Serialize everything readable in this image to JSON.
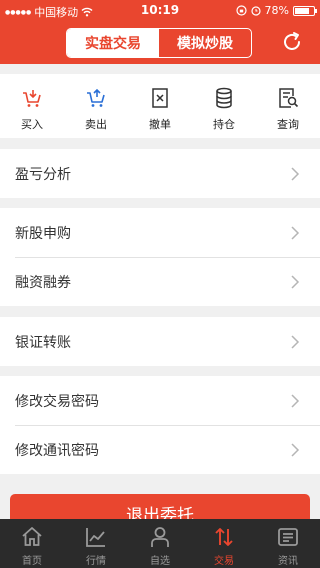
{
  "status_bar": {
    "carrier": "中国移动",
    "time": "10:19",
    "battery": "78%",
    "battery_level": 0.78
  },
  "header": {
    "tabs": [
      {
        "label": "实盘交易",
        "active": true
      },
      {
        "label": "模拟炒股",
        "active": false
      }
    ],
    "refresh_icon": "refresh-icon"
  },
  "actions": [
    {
      "label": "买入",
      "icon": "cart-in-icon",
      "color": "#e9462f"
    },
    {
      "label": "卖出",
      "icon": "cart-out-icon",
      "color": "#2a6fd6"
    },
    {
      "label": "撤单",
      "icon": "cancel-order-icon",
      "color": "#333333"
    },
    {
      "label": "持仓",
      "icon": "holdings-icon",
      "color": "#333333"
    },
    {
      "label": "查询",
      "icon": "query-icon",
      "color": "#333333"
    }
  ],
  "menu_groups": [
    {
      "items": [
        {
          "label": "盈亏分析"
        }
      ]
    },
    {
      "items": [
        {
          "label": "新股申购"
        },
        {
          "label": "融资融券"
        }
      ]
    },
    {
      "items": [
        {
          "label": "银证转账"
        }
      ]
    },
    {
      "items": [
        {
          "label": "修改交易密码"
        },
        {
          "label": "修改通讯密码"
        }
      ]
    }
  ],
  "logout_label": "退出委托",
  "tabbar": [
    {
      "label": "首页",
      "icon": "home-icon",
      "active": false
    },
    {
      "label": "行情",
      "icon": "market-chart-icon",
      "active": false
    },
    {
      "label": "自选",
      "icon": "person-icon",
      "active": false
    },
    {
      "label": "交易",
      "icon": "trade-icon",
      "active": true
    },
    {
      "label": "资讯",
      "icon": "news-icon",
      "active": false
    }
  ],
  "colors": {
    "accent": "#e9462f",
    "tabbar_bg": "#2b2b2b",
    "page_bg": "#f0f0f0"
  }
}
